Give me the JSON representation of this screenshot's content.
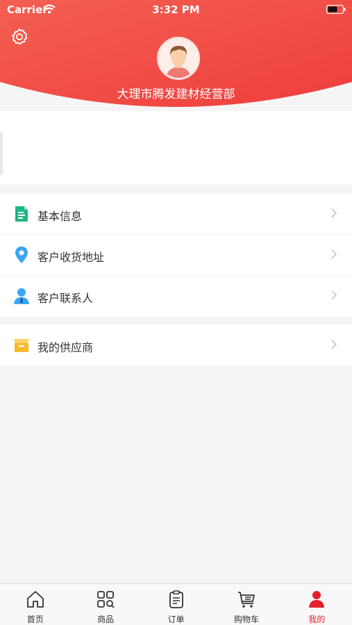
{
  "status_bar": {
    "carrier": "Carrier",
    "time": "3:32 PM"
  },
  "profile": {
    "company_name": "大理市腾发建材经营部"
  },
  "menu": {
    "group1": [
      {
        "label": "基本信息",
        "icon": "document-icon",
        "color": "#1fb584"
      },
      {
        "label": "客户收货地址",
        "icon": "location-pin-icon",
        "color": "#3aa6f2"
      },
      {
        "label": "客户联系人",
        "icon": "contact-person-icon",
        "color": "#3aa6f2"
      }
    ],
    "group2": [
      {
        "label": "我的供应商",
        "icon": "supplier-box-icon",
        "color": "#f5b92b"
      }
    ]
  },
  "tab_bar": {
    "items": [
      {
        "label": "首页",
        "icon": "home-icon"
      },
      {
        "label": "商品",
        "icon": "grid-icon"
      },
      {
        "label": "订单",
        "icon": "clipboard-icon"
      },
      {
        "label": "购物车",
        "icon": "cart-icon"
      },
      {
        "label": "我的",
        "icon": "user-icon",
        "active": true
      }
    ],
    "active_color": "#e4202b"
  },
  "colors": {
    "header_red": "#f04a42",
    "accent": "#e4202b"
  }
}
